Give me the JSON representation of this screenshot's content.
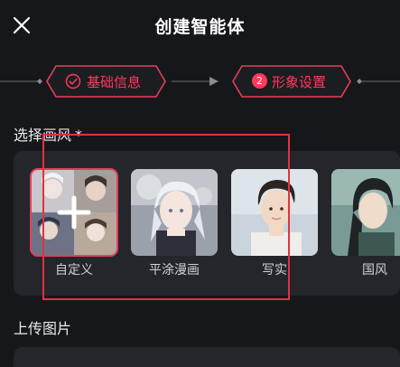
{
  "header": {
    "title": "创建智能体",
    "close_icon": "close-icon"
  },
  "steps": [
    {
      "label": "基础信息",
      "state": "completed",
      "icon": "check-circle-icon"
    },
    {
      "label": "形象设置",
      "state": "active",
      "number": "2"
    }
  ],
  "style_section": {
    "title": "选择画风",
    "required_mark": "*",
    "options": [
      {
        "name": "自定义",
        "selected": true,
        "icon": "plus-icon"
      },
      {
        "name": "平涂漫画",
        "selected": false
      },
      {
        "name": "写实",
        "selected": false
      },
      {
        "name": "国风",
        "selected": false
      }
    ]
  },
  "upload_section": {
    "title": "上传图片"
  },
  "colors": {
    "accent": "#ff3b5c",
    "background": "#16171b",
    "panel": "#25262b",
    "highlight_box": "#e0333d"
  }
}
